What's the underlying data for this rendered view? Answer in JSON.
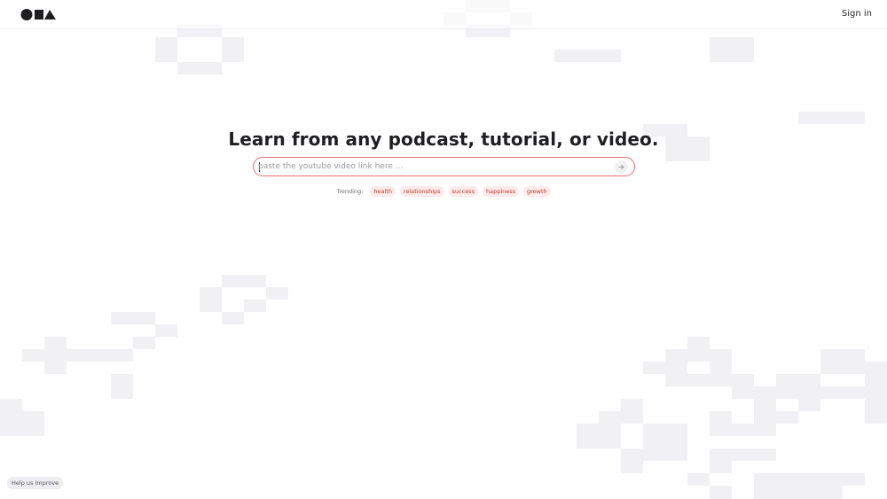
{
  "header": {
    "logo_icons": [
      "circle-shape-icon",
      "square-shape-icon",
      "triangle-shape-icon"
    ],
    "signin_label": "Sign in"
  },
  "hero": {
    "title": "Learn from any podcast, tutorial, or video."
  },
  "search": {
    "value": "",
    "placeholder": "paste the youtube video link here ...",
    "submit_icon": "arrow-right-icon"
  },
  "trending": {
    "label": "Trending:",
    "tags": [
      "health",
      "relationships",
      "success",
      "happiness",
      "growth"
    ]
  },
  "footer": {
    "help_label": "Help us improve"
  },
  "colors": {
    "accent_border": "#e57373",
    "tag_text": "#c0392b",
    "tag_bg": "#fdeaea",
    "text_dark": "#1f1f22",
    "bg_pixel": "#f1f1f3"
  }
}
